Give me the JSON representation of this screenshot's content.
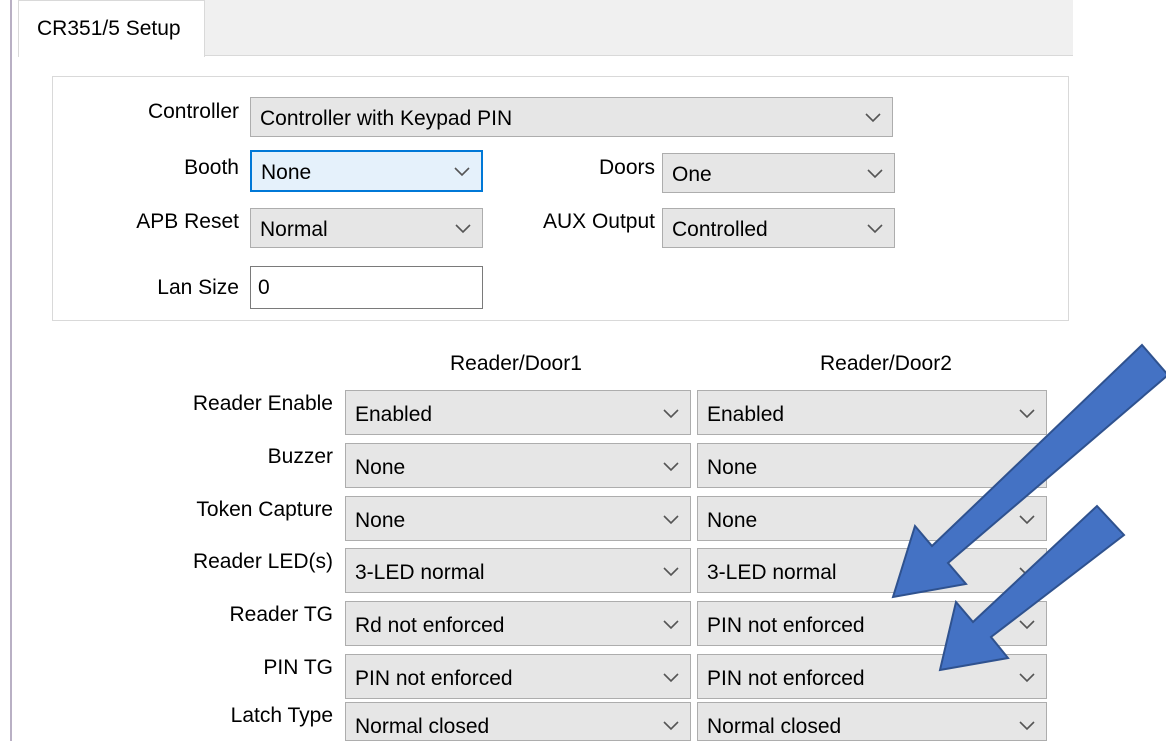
{
  "tab": {
    "label": "CR351/5 Setup"
  },
  "top": {
    "controller": {
      "label": "Controller",
      "value": "Controller with Keypad PIN"
    },
    "booth": {
      "label": "Booth",
      "value": "None"
    },
    "doors": {
      "label": "Doors",
      "value": "One"
    },
    "apb_reset": {
      "label": "APB Reset",
      "value": "Normal"
    },
    "aux_output": {
      "label": "AUX Output",
      "value": "Controlled"
    },
    "lan_size": {
      "label": "Lan Size",
      "value": "0"
    }
  },
  "readers": {
    "col1": "Reader/Door1",
    "col2": "Reader/Door2",
    "rows": [
      {
        "label": "Reader Enable",
        "door1": "Enabled",
        "door2": "Enabled"
      },
      {
        "label": "Buzzer",
        "door1": "None",
        "door2": "None"
      },
      {
        "label": "Token Capture",
        "door1": "None",
        "door2": "None"
      },
      {
        "label": "Reader LED(s)",
        "door1": "3-LED normal",
        "door2": "3-LED normal"
      },
      {
        "label": "Reader TG",
        "door1": "Rd not enforced",
        "door2": "PIN not enforced"
      },
      {
        "label": "PIN TG",
        "door1": "PIN not enforced",
        "door2": "PIN not enforced"
      },
      {
        "label": "Latch Type",
        "door1": "Normal closed",
        "door2": "Normal closed"
      }
    ]
  },
  "colors": {
    "arrow_fill": "#4472c4",
    "arrow_stroke": "#2f528f",
    "focus": "#0078d7"
  }
}
